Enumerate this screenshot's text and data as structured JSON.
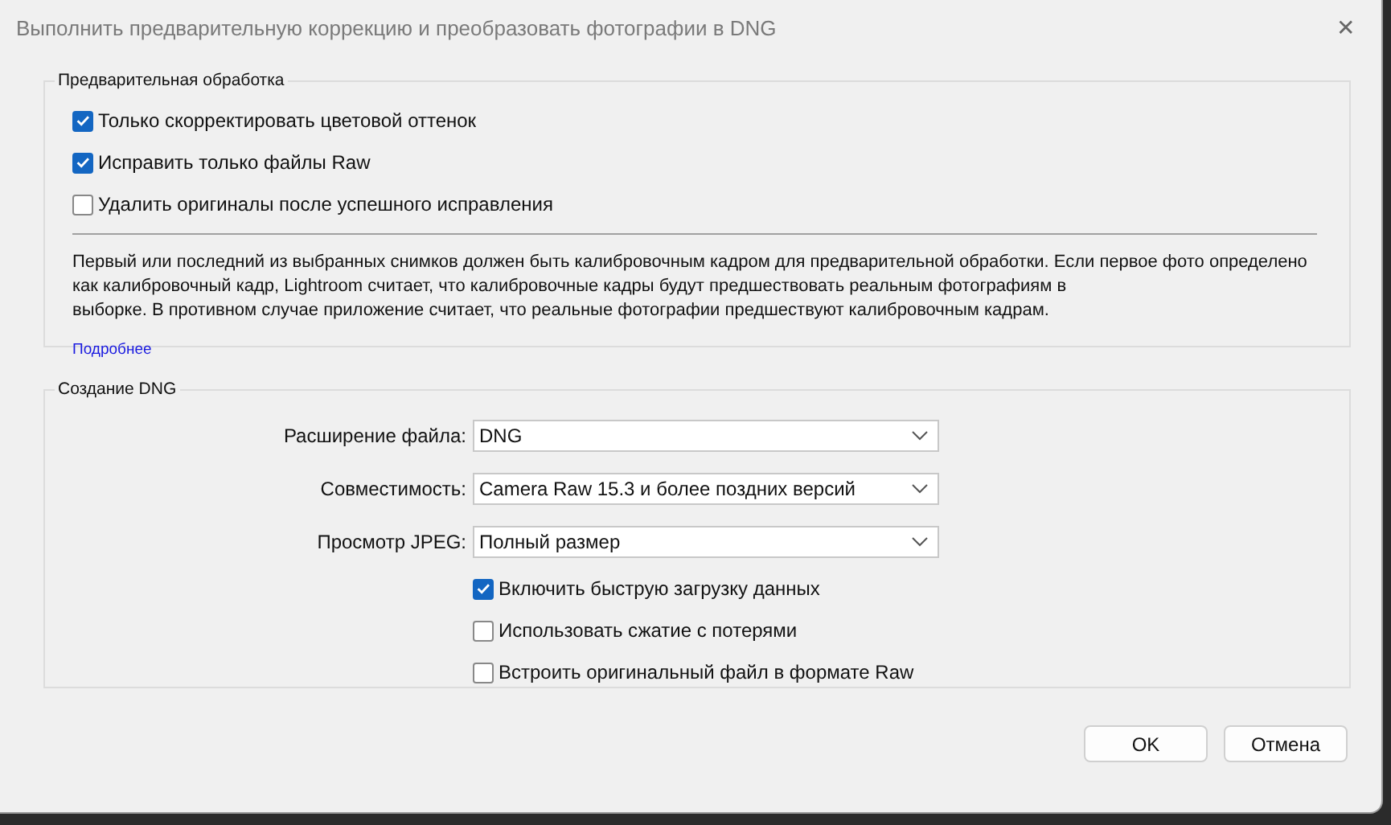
{
  "window": {
    "title": "Выполнить предварительную коррекцию и преобразовать фотографии в DNG",
    "close": "✕"
  },
  "preprocess": {
    "legend": "Предварительная обработка",
    "options": [
      {
        "label": "Только скорректировать цветовой оттенок",
        "checked": true
      },
      {
        "label": "Исправить только файлы Raw",
        "checked": true
      },
      {
        "label": "Удалить оригиналы после успешного исправления",
        "checked": false
      }
    ],
    "description": "Первый или последний из выбранных снимков должен быть калибровочным кадром для предварительной обработки. Если первое фото определено\nкак калибровочный кадр, Lightroom считает, что калибровочные кадры будут предшествовать реальным фотографиям в\nвыборке. В противном случае приложение считает, что реальные фотографии предшествуют калибровочным кадрам.",
    "link": "Подробнее"
  },
  "dng": {
    "legend": "Создание DNG",
    "fields": [
      {
        "label": "Расширение файла:",
        "value": "DNG"
      },
      {
        "label": "Совместимость:",
        "value": "Camera Raw 15.3 и более поздних версий"
      },
      {
        "label": "Просмотр JPEG:",
        "value": "Полный размер"
      }
    ],
    "options": [
      {
        "label": "Включить быструю загрузку данных",
        "checked": true
      },
      {
        "label": "Использовать сжатие с потерями",
        "checked": false
      },
      {
        "label": "Встроить оригинальный файл в формате Raw",
        "checked": false
      }
    ]
  },
  "buttons": [
    "OK",
    "Отмена"
  ]
}
